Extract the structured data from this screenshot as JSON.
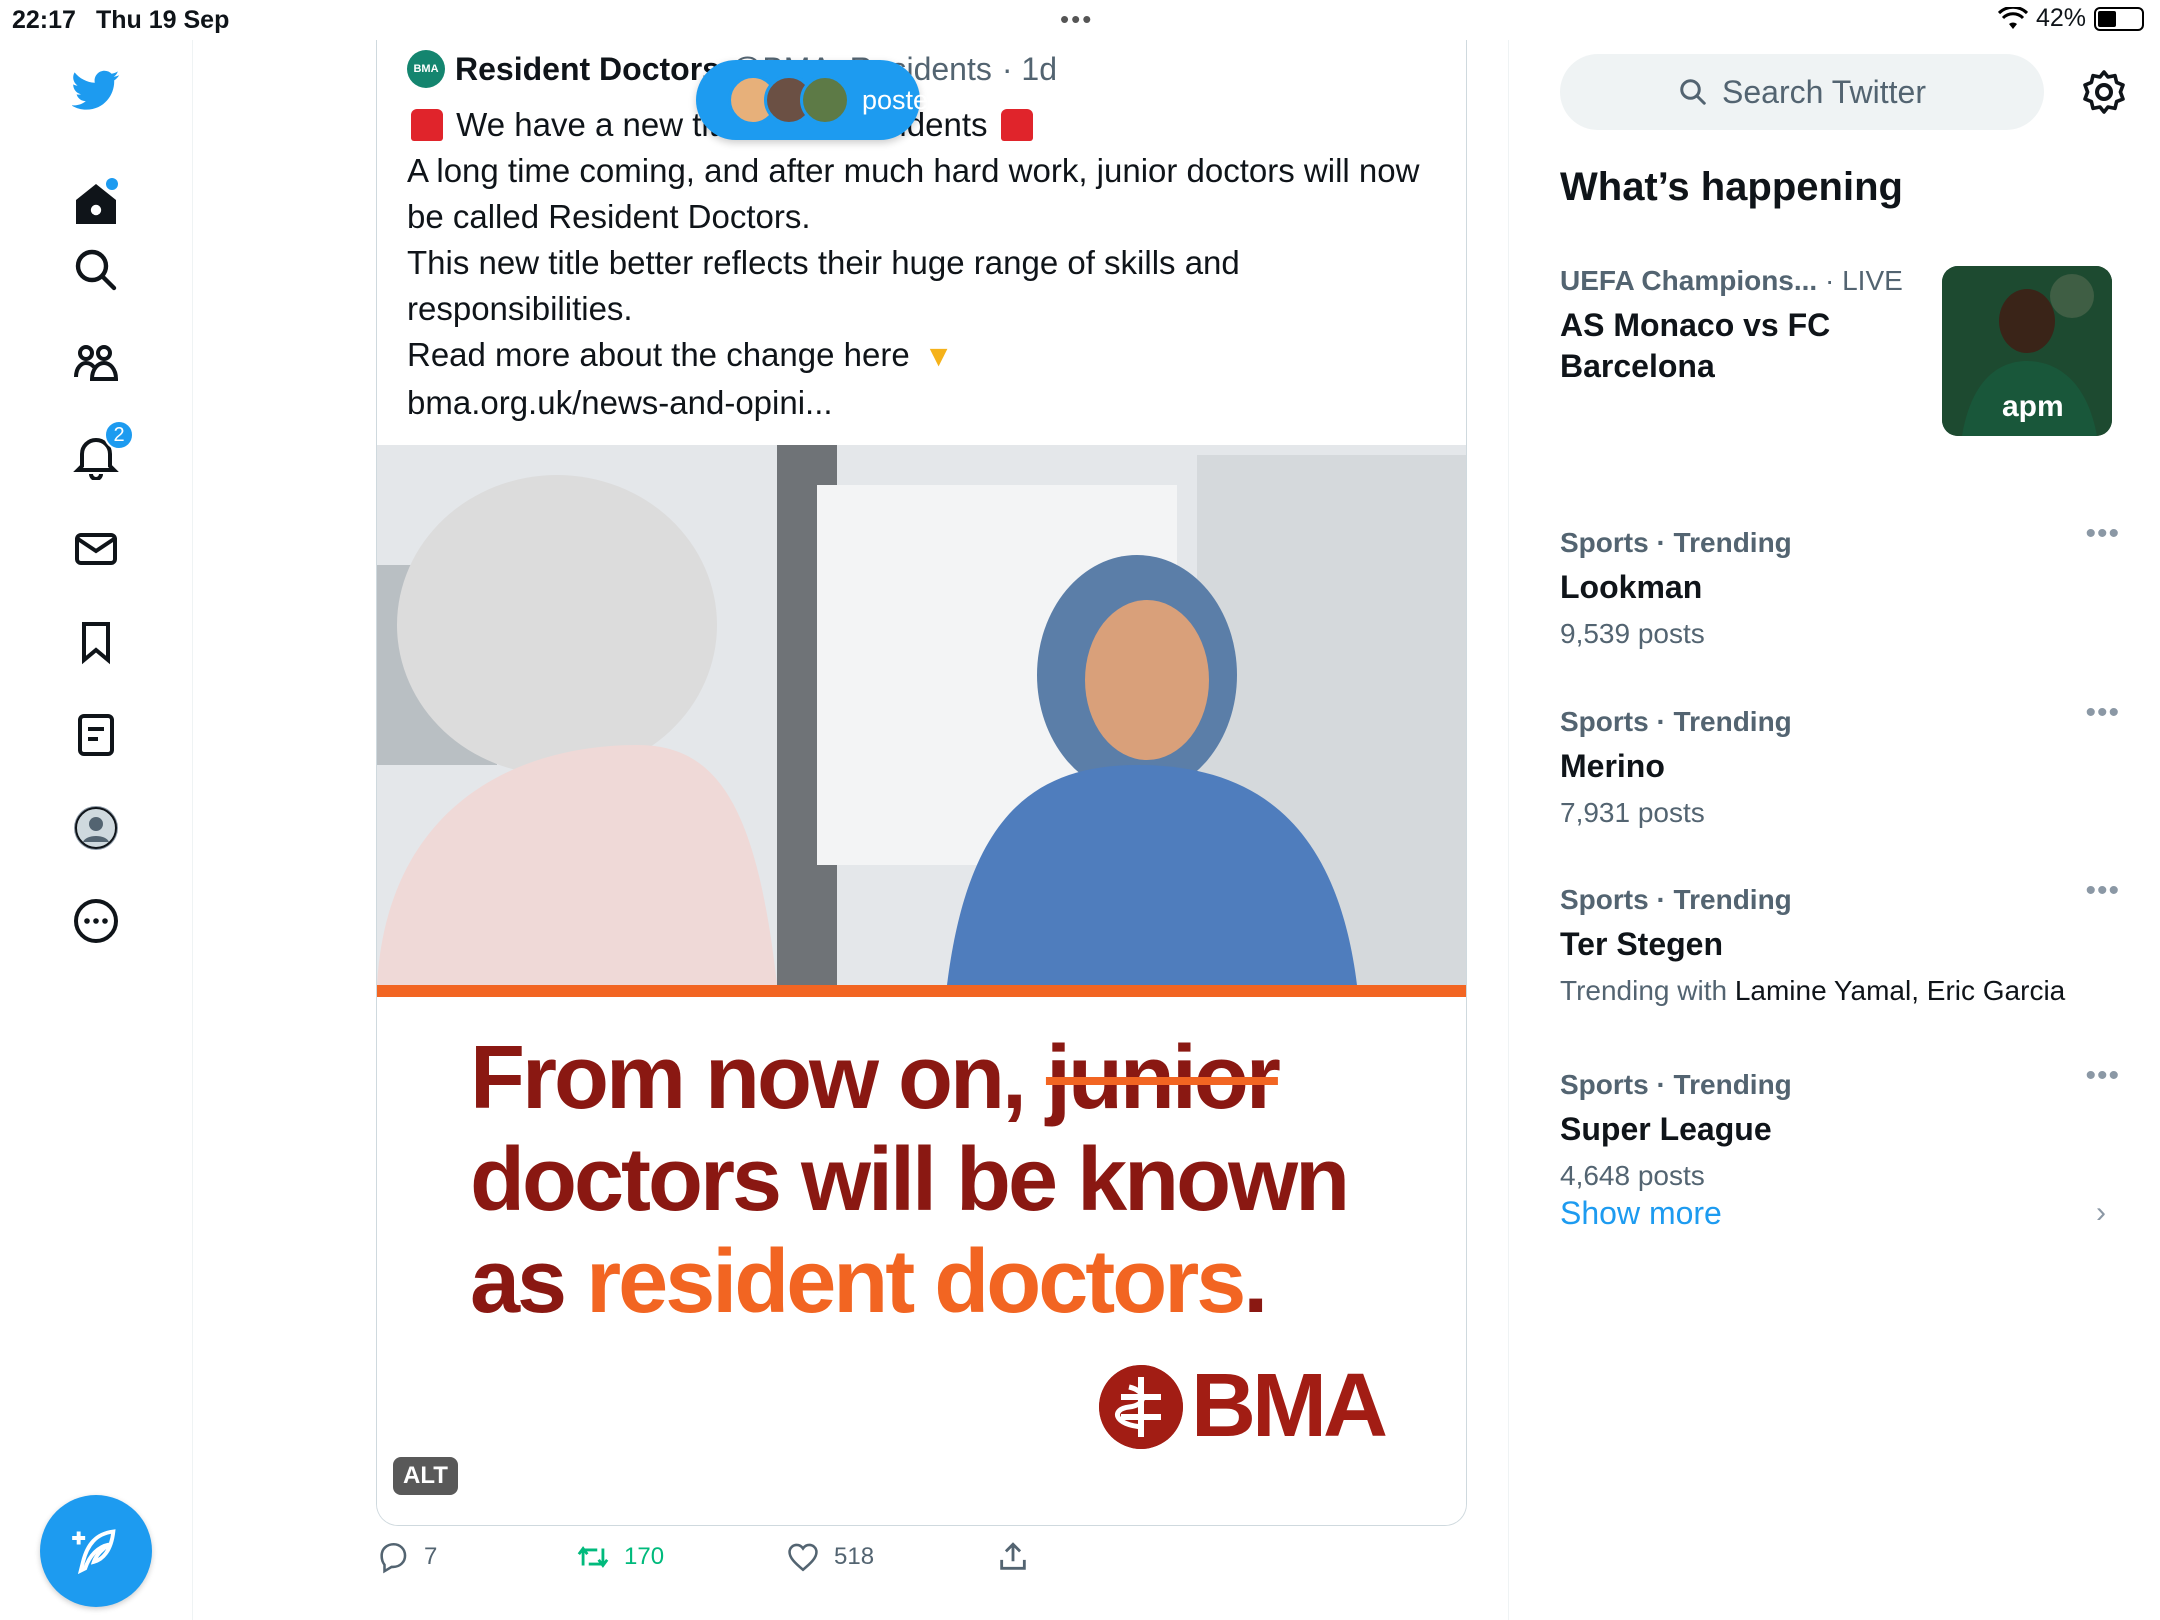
{
  "status_bar": {
    "time": "22:17",
    "date": "Thu 19 Sep",
    "battery": "42%"
  },
  "nav": {
    "notifications_count": "2"
  },
  "tweet": {
    "author_name": "Resident Doctors",
    "author_handle": "@BMA_Residents",
    "time_ago": "· 1d",
    "avatar_text": "BMA",
    "line1": "We have a new title: BMA Residents",
    "line2": "A long time coming, and after much hard work, junior doctors will now be called Resident Doctors.",
    "line3": "This new title better reflects their huge range of skills and responsibilities.",
    "line4": "Read more about the change here",
    "line5": "bma.org.uk/news-and-opini...",
    "image": {
      "caption_a": "From now on, ",
      "caption_strike": "junior",
      "caption_b": "doctors will be known",
      "caption_c": "as ",
      "caption_orange": "resident doctors",
      "caption_d": ".",
      "logo_text": "BMA",
      "alt_label": "ALT"
    },
    "actions": {
      "replies": "7",
      "retweets": "170",
      "likes": "518"
    }
  },
  "posted_pill": {
    "label": "posted"
  },
  "sidebar": {
    "search_placeholder": "Search Twitter",
    "section_title": "What’s happening",
    "live": {
      "category": "UEFA Champions...",
      "live_tag": " · LIVE",
      "title": "AS Monaco vs FC Barcelona"
    },
    "trends": [
      {
        "category": "Sports · Trending",
        "name": "Lookman",
        "meta": "9,539 posts"
      },
      {
        "category": "Sports · Trending",
        "name": "Merino",
        "meta": "7,931 posts"
      },
      {
        "category": "Sports · Trending",
        "name": "Ter Stegen",
        "meta_prefix": "Trending with ",
        "meta_with": "Lamine Yamal, Eric Garcia"
      },
      {
        "category": "Sports · Trending",
        "name": "Super League",
        "meta": "4,648 posts"
      }
    ],
    "show_more": "Show more"
  },
  "colors": {
    "accent": "#1d9bf0",
    "retweet": "#00ba7c",
    "bma_red": "#8a1812",
    "bma_orange": "#f26522"
  },
  "icons": [
    "twitter-bird-icon",
    "home-icon",
    "search-icon",
    "communities-icon",
    "bell-icon",
    "mail-icon",
    "bookmark-icon",
    "lists-icon",
    "profile-icon",
    "more-icon",
    "compose-icon",
    "reply-icon",
    "retweet-icon",
    "like-icon",
    "share-icon",
    "settings-icon",
    "chevron-right-icon"
  ]
}
